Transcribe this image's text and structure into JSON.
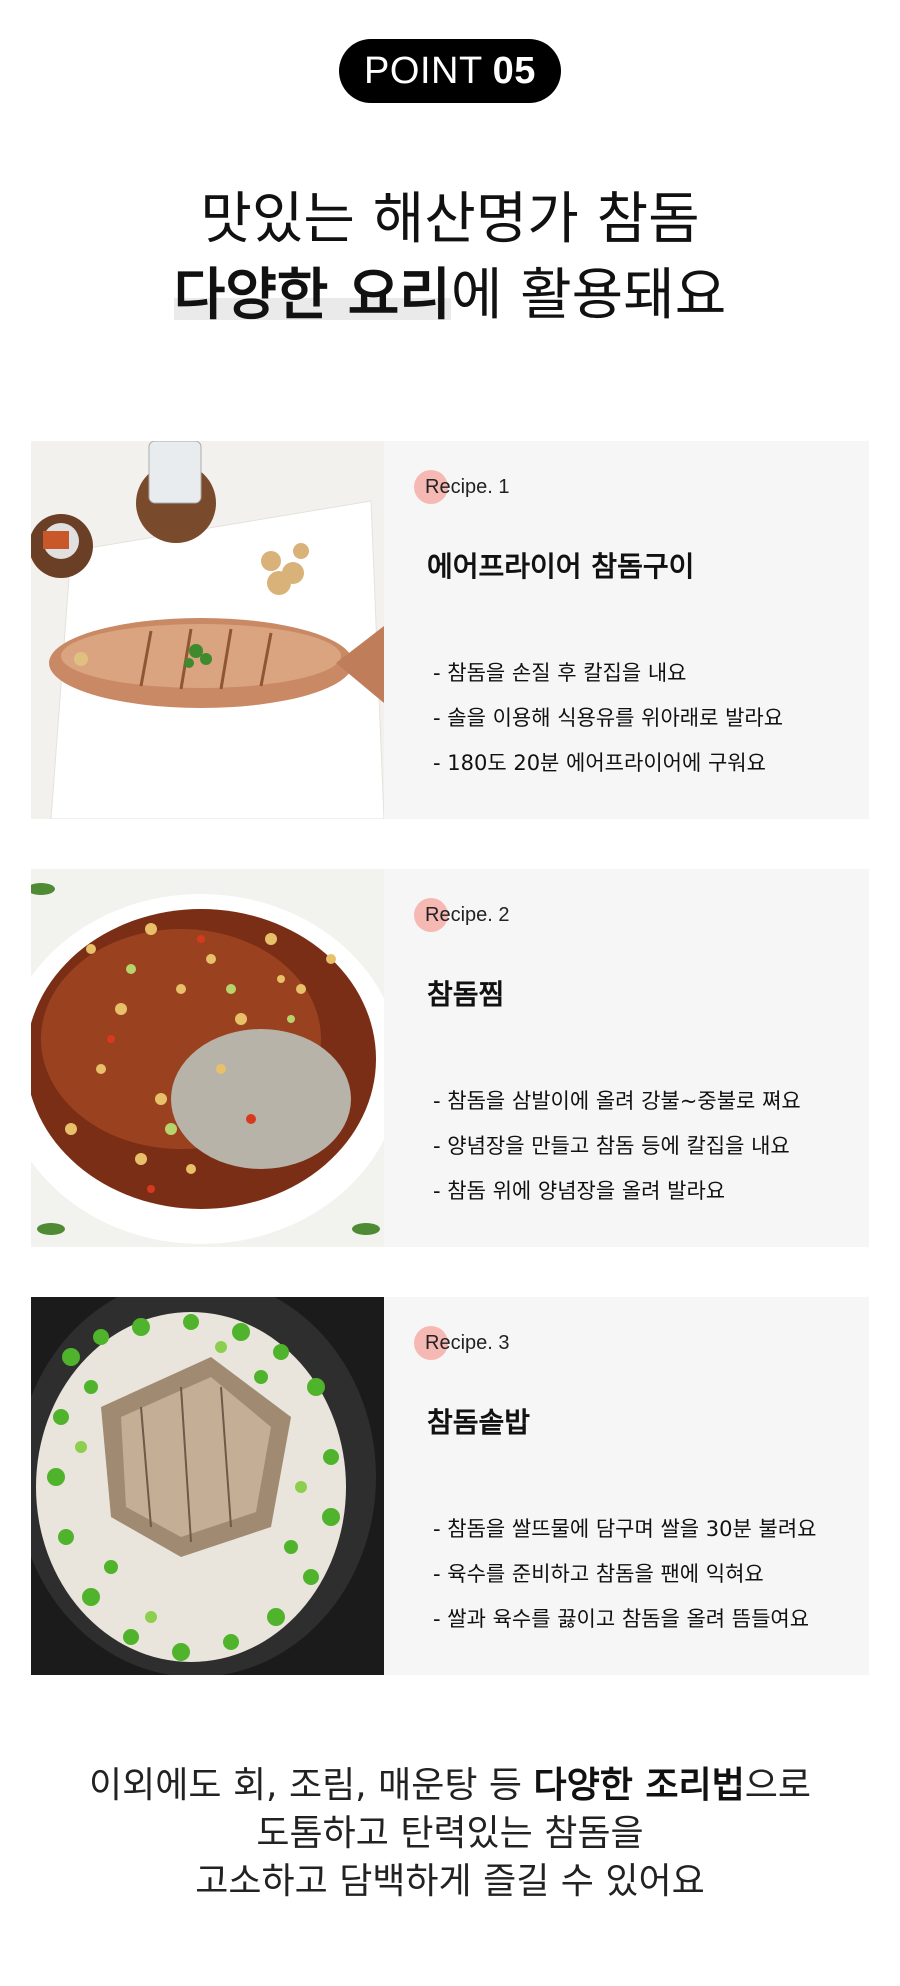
{
  "point": {
    "label": "POINT",
    "number": "05"
  },
  "headline": {
    "line1": "맛있는 해산명가 참돔",
    "line2_bold": "다양한 요리",
    "line2_rest": "에 활용돼요"
  },
  "recipes": [
    {
      "tag": "Recipe. 1",
      "title": "에어프라이어 참돔구이",
      "steps": [
        "- 참돔을 손질 후 칼집을 내요",
        "- 솔을 이용해 식용유를 위아래로 발라요",
        "- 180도 20분 에어프라이어에 구워요"
      ],
      "photo": "grilled-sea-bream-photo"
    },
    {
      "tag": "Recipe. 2",
      "title": "참돔찜",
      "steps": [
        "- 참돔을 삼발이에 올려 강불~중불로 쪄요",
        "- 양념장을 만들고 참돔 등에 칼집을 내요",
        "- 참돔 위에 양념장을 올려 발라요"
      ],
      "photo": "steamed-sea-bream-photo"
    },
    {
      "tag": "Recipe. 3",
      "title": "참돔솥밥",
      "steps": [
        "- 참돔을 쌀뜨물에 담구며 쌀을 30분 불려요",
        "- 육수를 준비하고 참돔을 팬에 익혀요",
        "- 쌀과 육수를 끓이고 참돔을 올려 뜸들여요"
      ],
      "photo": "sea-bream-pot-rice-photo"
    }
  ],
  "closing": {
    "line1_pre": "이외에도 회, 조림, 매운탕 등 ",
    "line1_bold": "다양한 조리법",
    "line1_post": "으로",
    "line2": "도톰하고 탄력있는 참돔을",
    "line3": "고소하고 담백하게 즐길 수 있어요"
  },
  "colors": {
    "pill_bg": "#000000",
    "card_bg": "#f6f6f6",
    "tag_dot": "#f6b8b3"
  }
}
